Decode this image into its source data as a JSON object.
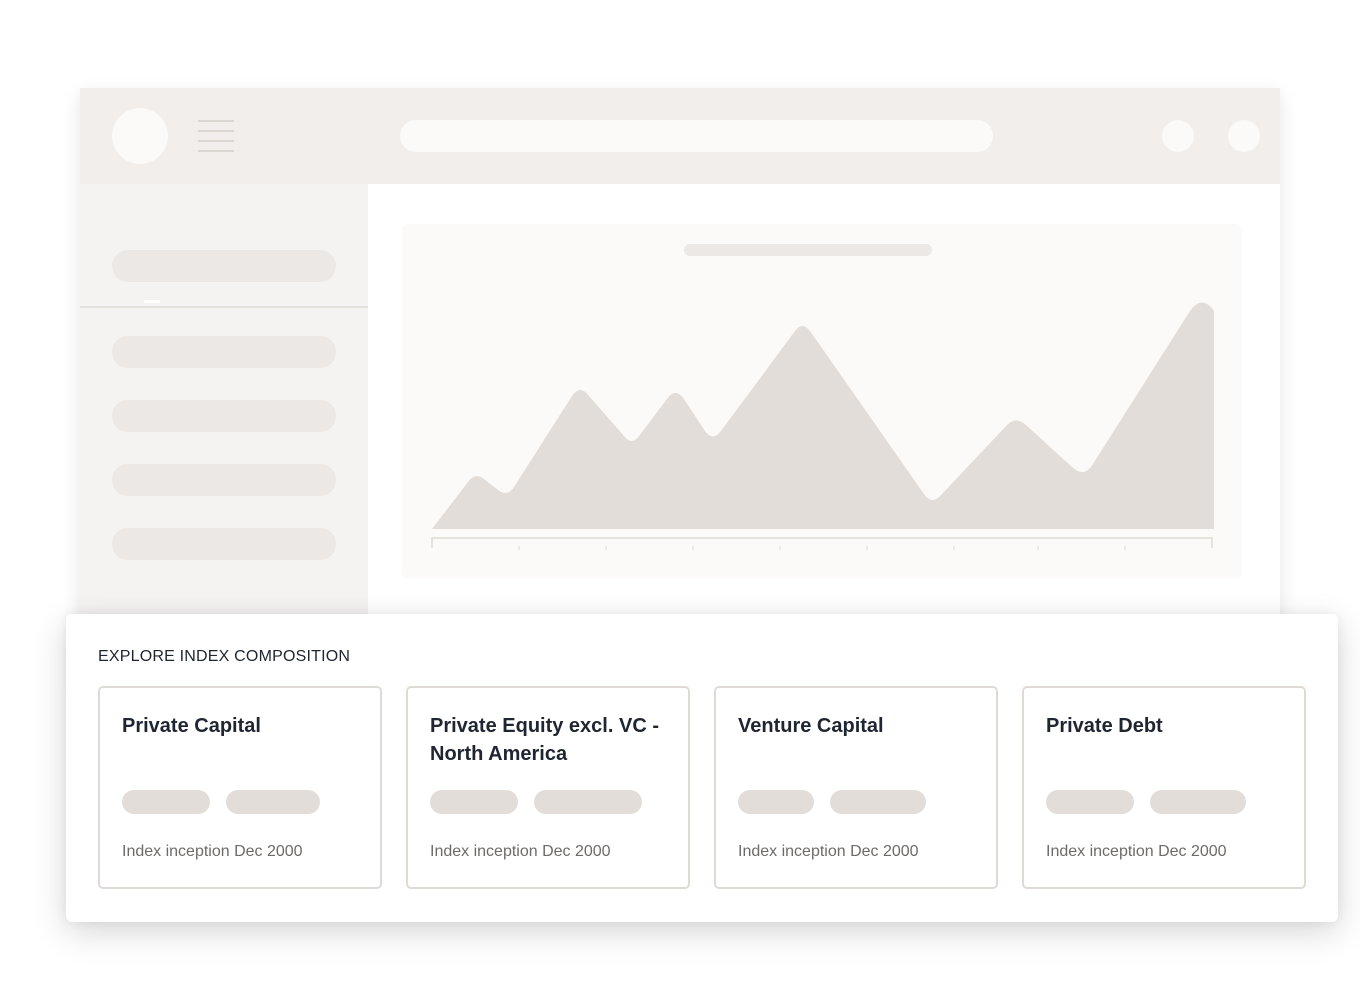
{
  "panel": {
    "heading": "EXPLORE INDEX COMPOSITION",
    "cards": [
      {
        "title": "Private Capital",
        "inception": "Index inception Dec 2000"
      },
      {
        "title": "Private Equity excl. VC - North America",
        "inception": "Index inception Dec 2000"
      },
      {
        "title": "Venture Capital",
        "inception": "Index inception Dec 2000"
      },
      {
        "title": "Private Debt",
        "inception": "Index inception Dec 2000"
      }
    ]
  },
  "colors": {
    "placeholder": "#e2ddd8",
    "topbar": "#f1eeeb",
    "sidebar": "#f5f3f1",
    "card_border": "#dedad6",
    "heading_text": "#1e2430",
    "muted_text": "#6d6b69"
  }
}
